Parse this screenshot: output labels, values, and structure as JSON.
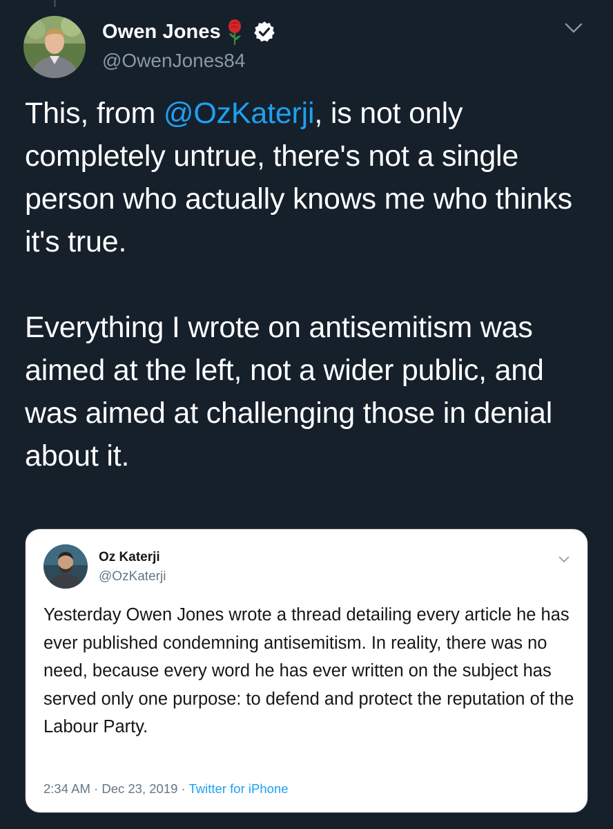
{
  "tweet": {
    "display_name": "Owen Jones",
    "handle": "@OwenJones84",
    "body_pre": "This, from ",
    "mention": "@OzKaterji",
    "body_post": ", is not only completely untrue, there's not a single person who actually knows me who thinks it's true.",
    "body_paragraph_2": "Everything I wrote on antisemitism was aimed at the left, not a wider public, and was aimed at challenging those in denial about it.",
    "icons": {
      "rose": "rose-icon",
      "verified": "verified-badge-icon",
      "menu": "chevron-down-icon"
    }
  },
  "quoted_tweet": {
    "display_name": "Oz Katerji",
    "handle": "@OzKaterji",
    "text": "Yesterday Owen Jones wrote a thread detailing every article he has ever published condemning antisemitism. In reality, there was no need, because every word he has ever written on the subject has served only one purpose: to defend and protect the reputation of the Labour Party.",
    "time": "2:34 AM",
    "date": "Dec 23, 2019",
    "separator": "·",
    "source": "Twitter for iPhone"
  },
  "colors": {
    "background": "#15202b",
    "accent": "#1da1f2",
    "secondary_text": "#8899a6",
    "card_background": "#ffffff"
  }
}
